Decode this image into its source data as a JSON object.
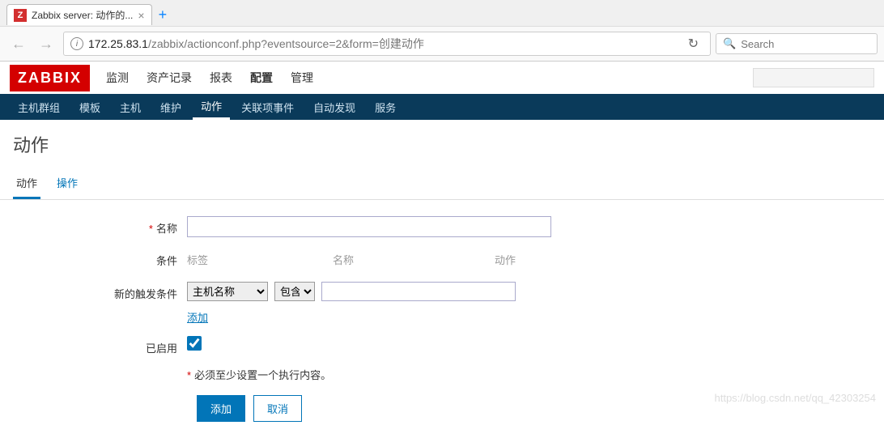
{
  "browser": {
    "tab_title": "Zabbix server: 动作的...",
    "tab_favicon": "Z",
    "url_host": "172.25.83.1",
    "url_path": "/zabbix/actionconf.php?eventsource=2&form=创建动作",
    "search_placeholder": "Search"
  },
  "header": {
    "logo": "ZABBIX",
    "nav": [
      "监测",
      "资产记录",
      "报表",
      "配置",
      "管理"
    ],
    "nav_active": "配置"
  },
  "subnav": {
    "items": [
      "主机群组",
      "模板",
      "主机",
      "维护",
      "动作",
      "关联项事件",
      "自动发现",
      "服务"
    ],
    "active": "动作"
  },
  "page": {
    "title": "动作",
    "tabs": [
      "动作",
      "操作"
    ],
    "tab_active": "动作"
  },
  "form": {
    "name_label": "名称",
    "name_value": "",
    "conditions_label": "条件",
    "cond_headers": {
      "label": "标签",
      "name": "名称",
      "action": "动作"
    },
    "new_trigger_label": "新的触发条件",
    "trigger_type_options": [
      "主机名称"
    ],
    "trigger_op_options": [
      "包含"
    ],
    "trigger_value": "",
    "add_link": "添加",
    "enabled_label": "已启用",
    "enabled_checked": true,
    "warning": "必须至少设置一个执行内容。",
    "submit": "添加",
    "cancel": "取消"
  },
  "watermark": "https://blog.csdn.net/qq_42303254"
}
